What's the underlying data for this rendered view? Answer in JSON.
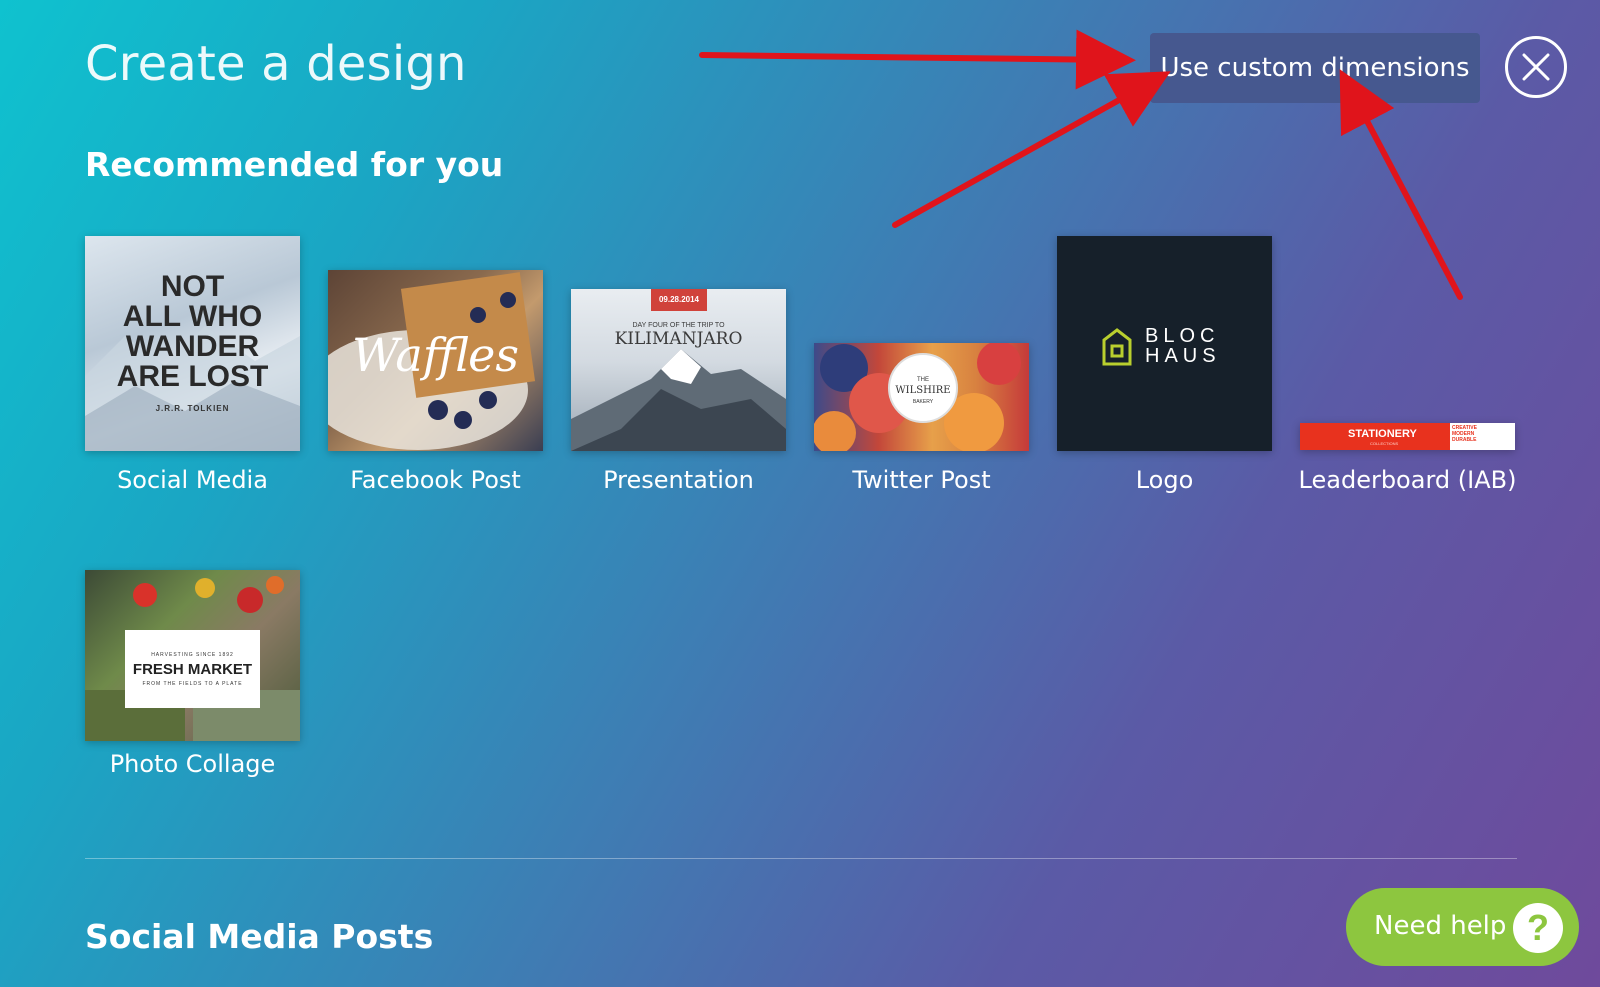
{
  "header": {
    "title": "Create a design",
    "custom_dimensions_label": "Use custom dimensions",
    "close_icon": "close-icon"
  },
  "sections": {
    "recommended_title": "Recommended for you",
    "social_posts_title": "Social Media Posts"
  },
  "cards": [
    {
      "label": "Social Media",
      "thumb_lines": [
        "NOT",
        "ALL WHO",
        "WANDER",
        "ARE LOST"
      ],
      "thumb_credit": "J.R.R. TOLKIEN"
    },
    {
      "label": "Facebook Post",
      "thumb_text": "Waffles"
    },
    {
      "label": "Presentation",
      "thumb_date": "09.28.2014",
      "thumb_subtitle": "DAY FOUR OF THE TRIP TO",
      "thumb_title": "KILIMANJARO"
    },
    {
      "label": "Twitter Post",
      "thumb_top": "THE",
      "thumb_name": "WILSHIRE",
      "thumb_bottom": "BAKERY"
    },
    {
      "label": "Logo",
      "thumb_line1": "BLOC",
      "thumb_line2": "HAUS"
    },
    {
      "label": "Leaderboard (IAB)",
      "thumb_brand": "STATIONERY",
      "thumb_sub": "COLLECTIONS",
      "thumb_tags": [
        "CREATIVE",
        "MODERN",
        "DURABLE"
      ]
    },
    {
      "label": "Photo Collage",
      "thumb_top": "HARVESTING SINCE 1892",
      "thumb_title": "FRESH MARKET",
      "thumb_bottom": "FROM THE FIELDS TO A PLATE"
    }
  ],
  "help": {
    "label": "Need help",
    "icon_text": "?"
  },
  "colors": {
    "custom_button": "#46588f",
    "help_button": "#8dc63f",
    "annotation_arrow": "#e0141b"
  }
}
